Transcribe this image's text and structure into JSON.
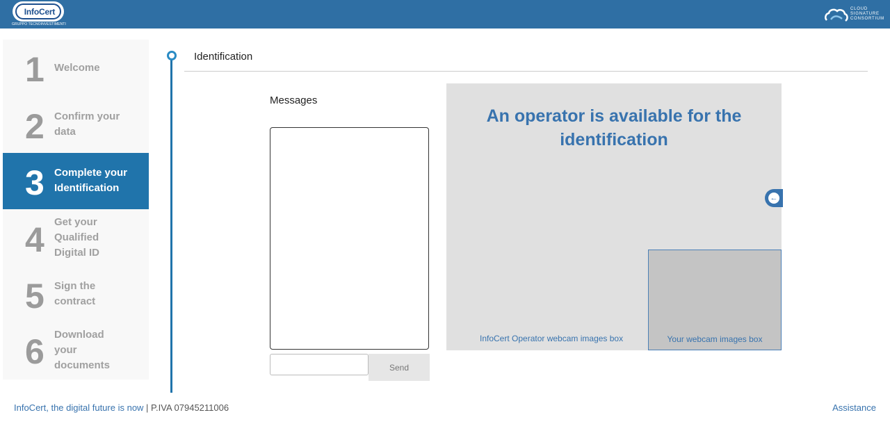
{
  "header": {
    "logo_text": "InfoCert",
    "logo_subtitle": "GRUPPO TECNOINVESTIMENTI",
    "partner_text": [
      "CLOUD",
      "SIGNATURE",
      "CONSORTIUM"
    ]
  },
  "steps": [
    {
      "number": "1",
      "label": [
        "Welcome"
      ],
      "active": false
    },
    {
      "number": "2",
      "label": [
        "Confirm your",
        "data"
      ],
      "active": false
    },
    {
      "number": "3",
      "label": [
        "Complete your",
        "Identification"
      ],
      "active": true
    },
    {
      "number": "4",
      "label": [
        "Get your",
        "Qualified",
        "Digital ID"
      ],
      "active": false
    },
    {
      "number": "5",
      "label": [
        "Sign the",
        "contract"
      ],
      "active": false
    },
    {
      "number": "6",
      "label": [
        "Download",
        "your",
        "documents"
      ],
      "active": false
    }
  ],
  "section": {
    "title": "Identification"
  },
  "messages": {
    "label": "Messages",
    "input_value": "",
    "send_label": "Send"
  },
  "video": {
    "operator_message": [
      "An operator is available for the",
      "identification"
    ],
    "operator_caption": "InfoCert Operator webcam images box",
    "self_caption": "Your webcam images box"
  },
  "footer": {
    "tagline": "InfoCert, the digital future is now",
    "separator": " | ",
    "vat": "P.IVA 07945211006",
    "assistance": "Assistance"
  },
  "colors": {
    "header": "#2f6fa4",
    "active_step": "#2074ab",
    "accent_text": "#3873ae"
  }
}
